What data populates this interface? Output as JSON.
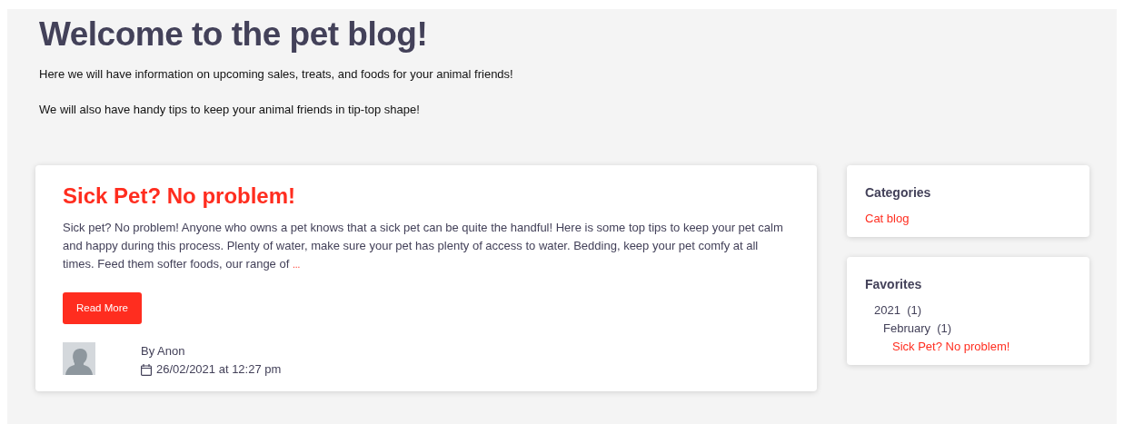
{
  "header": {
    "title": "Welcome to the pet blog!",
    "paragraphs": [
      "Here we will have information on upcoming sales, treats, and foods for your animal friends!",
      "We will also have handy tips to keep your animal friends in tip-top shape!"
    ]
  },
  "post": {
    "title": "Sick Pet? No problem!",
    "excerpt": "Sick pet? No problem! Anyone who owns a pet knows that a sick pet can be quite the handful! Here is some top tips to keep your pet calm and happy during this process. Plenty of water, make sure your pet has plenty of access to water.  Bedding, keep your pet comfy at all times. Feed them softer foods, our range of",
    "more_link": "...",
    "button": "Read More",
    "author": "By Anon",
    "date": "26/02/2021 at 12:27 pm"
  },
  "sidebar": {
    "categories": {
      "title": "Categories",
      "items": [
        "Cat blog"
      ]
    },
    "favorites": {
      "title": "Favorites",
      "tree": [
        {
          "label": "2021",
          "count": "(1)",
          "children": [
            {
              "label": "February",
              "count": "(1)",
              "children": [
                {
                  "label": "Sick Pet? No problem!",
                  "kind": "link"
                }
              ]
            }
          ]
        }
      ]
    }
  }
}
